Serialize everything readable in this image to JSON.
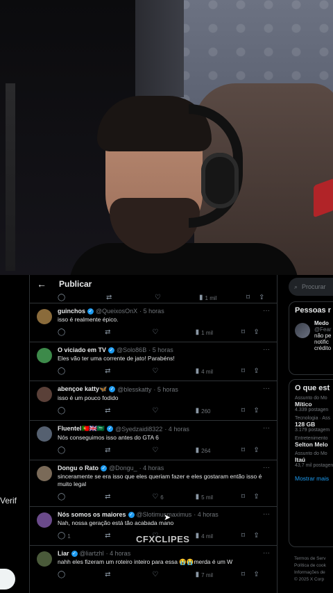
{
  "screen": {
    "left": {
      "verif_fragment": "Verif"
    },
    "header": {
      "title": "Publicar"
    },
    "top_actions": {
      "views": "1 mil"
    },
    "posts": [
      {
        "name": "guinchos",
        "handle": "@QueixosOnX",
        "time": "· 5 horas",
        "text": "isso é realmente épico.",
        "replies": "",
        "likes": "",
        "views": "1 mil",
        "avatar_color": "#8a6b3b"
      },
      {
        "name": "O viciado em TV",
        "handle": "@Solo86B",
        "time": "· 5 horas",
        "text": "Eles vão ter uma corrente de jato! Parabéns!",
        "replies": "",
        "likes": "",
        "views": "4 mil",
        "avatar_color": "#3d8a4a"
      },
      {
        "name": "abençoe katty🦋",
        "handle": "@blesskatty",
        "time": "· 5 horas",
        "text": "isso é um pouco fodido",
        "replies": "",
        "likes": "",
        "views": "260",
        "avatar_color": "#5a4038"
      },
      {
        "name": "Fluentel🇵🇹🇬🇧🇸🇦",
        "handle": "@Syedzaidi8322",
        "time": "· 4 horas",
        "text": "Nós conseguimos isso antes do GTA 6",
        "replies": "",
        "likes": "",
        "views": "264",
        "avatar_color": "#556070"
      },
      {
        "name": "Dongu o Rato",
        "handle": "@Dongu_",
        "time": "· 4 horas",
        "text": "sinceramente se era isso que eles queriam fazer e eles gostaram então isso é muito legal",
        "replies": "",
        "likes": "6",
        "views": "5 mil",
        "avatar_color": "#7a6a58"
      },
      {
        "name": "Nós somos os maiores",
        "handle": "@Slotimusmaximus",
        "time": "· 4 horas",
        "text": "Nah, nossa geração está tão acabada mano",
        "replies": "1",
        "likes": "",
        "views": "4 mil",
        "avatar_color": "#6a4a8a"
      },
      {
        "name": "Liar",
        "handle": "@liartzhl",
        "time": "· 4 horas",
        "text": "nahh eles fizeram um roteiro inteiro para essa 😭😭merda é um W",
        "replies": "",
        "likes": "",
        "views": "7 mil",
        "avatar_color": "#4a5a3a"
      }
    ],
    "sidebar": {
      "search_placeholder": "Procurar",
      "people_title": "Pessoas r",
      "person": {
        "name": "Medo",
        "handle": "@Fear",
        "bio": "não pe notific crédito"
      },
      "trends_title": "O que est",
      "trends": [
        {
          "category": "Assunto do Mo",
          "name": "Mítico",
          "count": "4.339 postagen"
        },
        {
          "category": "Tecnologia · Ass",
          "name": "128 GB",
          "count": "3.179 postagem"
        },
        {
          "category": "Entretenimento",
          "name": "Selton Melo",
          "count": ""
        },
        {
          "category": "Assunto do Mo",
          "name": "Itaú",
          "count": "43,7 mil postagen"
        }
      ],
      "show_more": "Mostrar mais",
      "footer": [
        "Termos de Serv",
        "Política de cook",
        "Informações de",
        "© 2025 X Corp"
      ]
    }
  },
  "overlay": {
    "watermark": "CFXCLIPES"
  }
}
